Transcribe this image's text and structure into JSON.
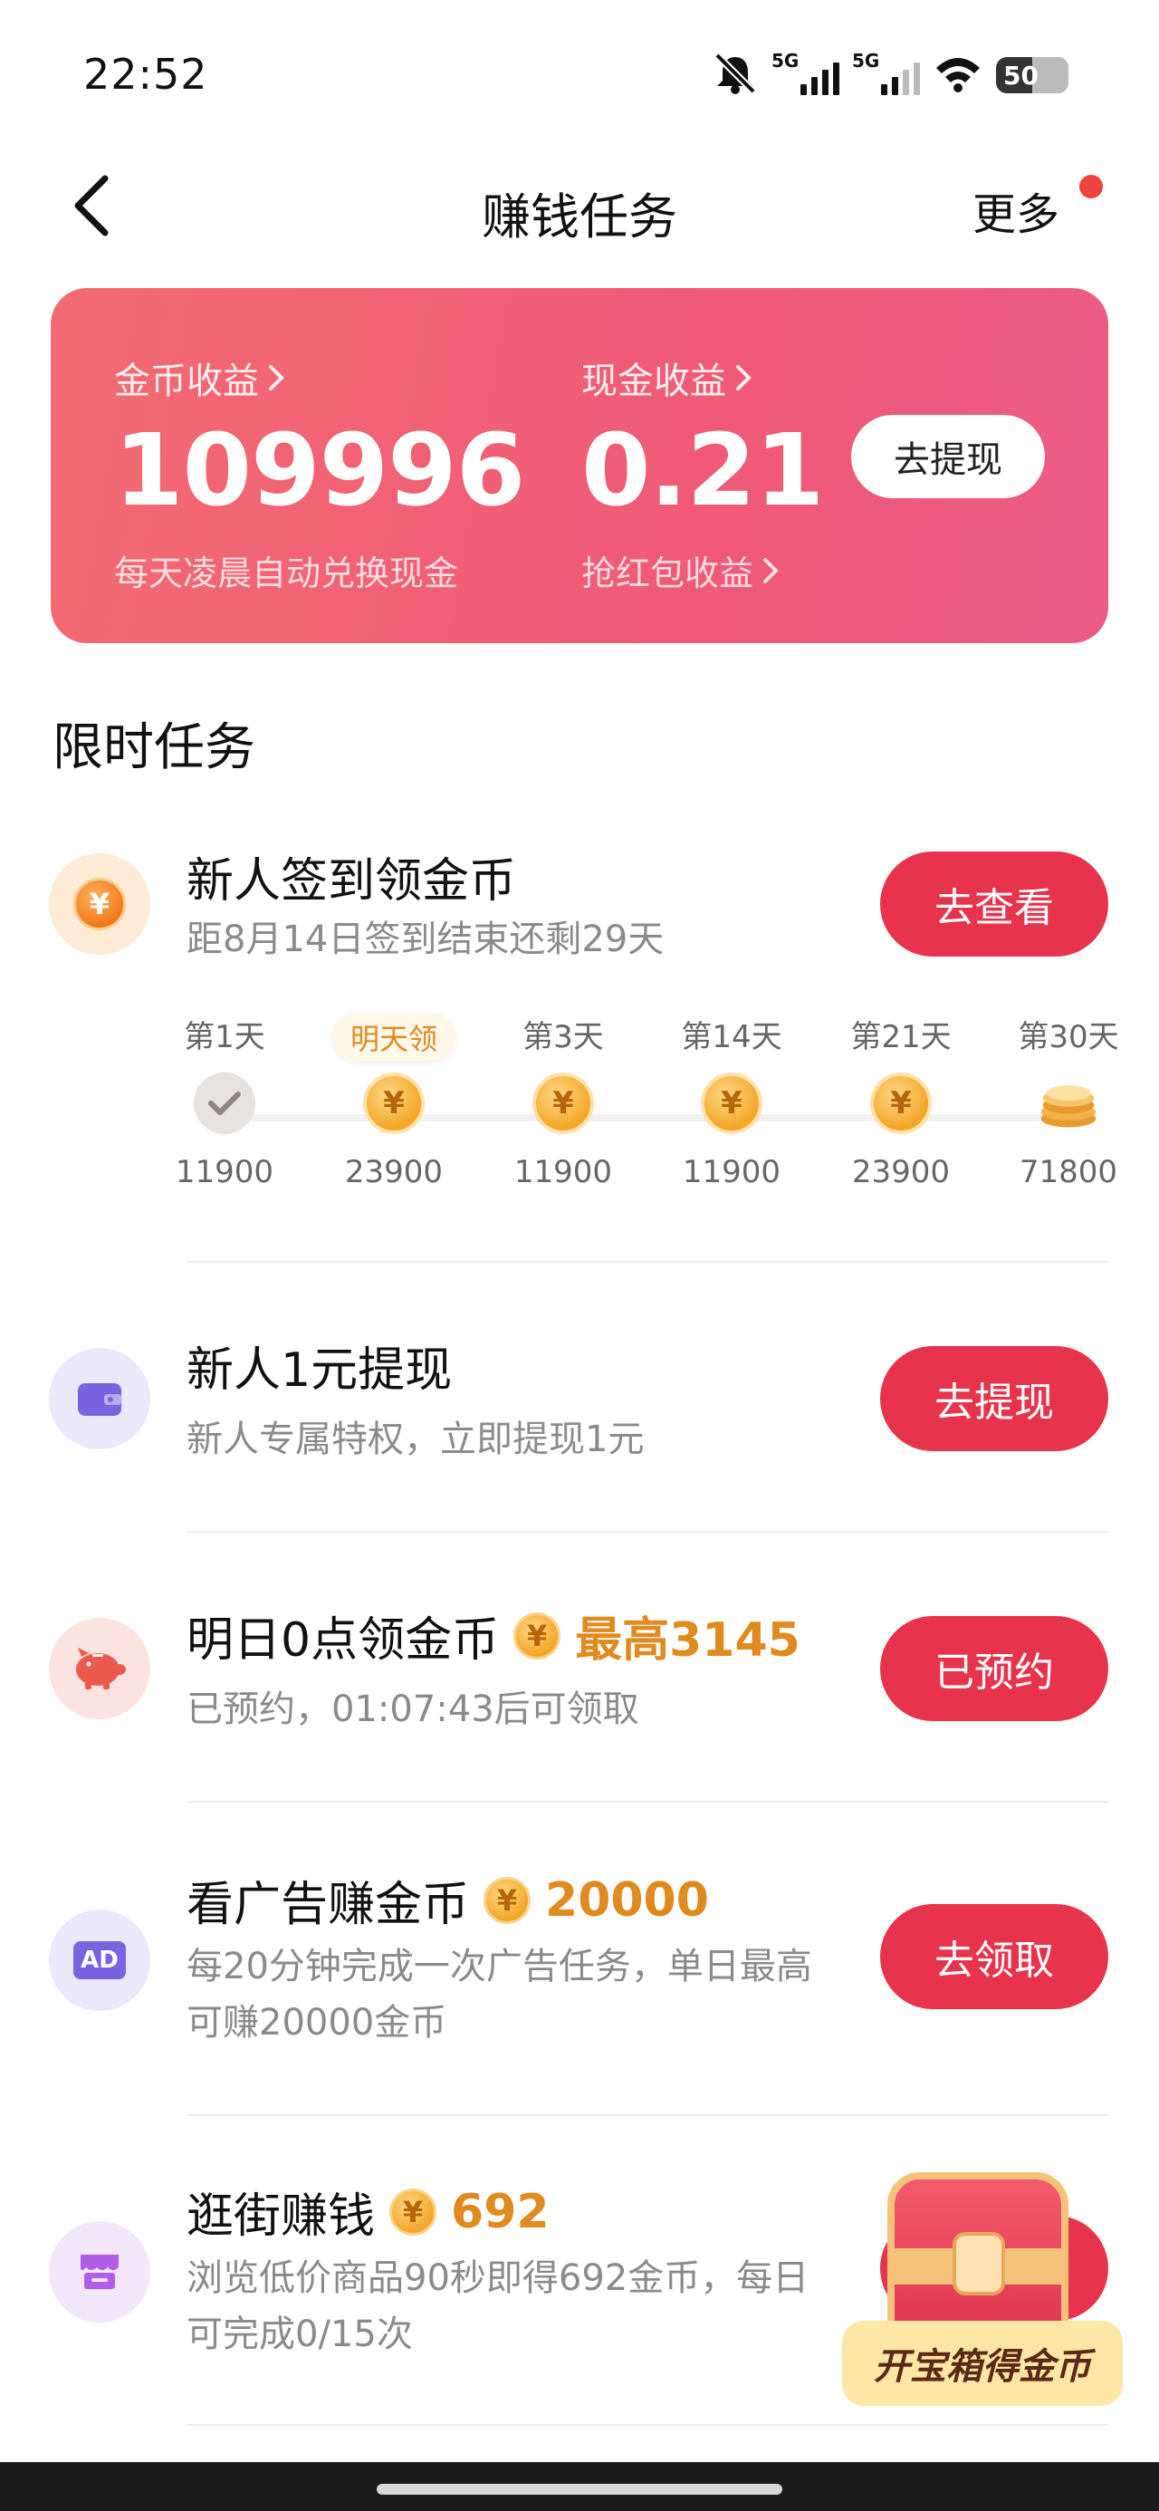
{
  "status_bar": {
    "time": "22:52",
    "network1": "5G",
    "network2": "5G",
    "battery": "50",
    "icons": [
      "mute-icon",
      "signal-icon",
      "wifi-icon",
      "battery-icon"
    ]
  },
  "header": {
    "title": "赚钱任务",
    "more_label": "更多"
  },
  "earnings": {
    "coins_label": "金币收益",
    "coins_value": "109996",
    "coins_note": "每天凌晨自动兑换现金",
    "cash_label": "现金收益",
    "cash_value": "0.21",
    "cash_note": "抢红包收益",
    "withdraw_label": "去提现"
  },
  "section_title": "限时任务",
  "tasks": [
    {
      "title": "新人签到领金币",
      "desc": "距8月14日签到结束还剩29天",
      "button": "去查看"
    },
    {
      "title": "新人1元提现",
      "desc": "新人专属特权，立即提现1元",
      "button": "去提现"
    },
    {
      "title": "明日0点领金币",
      "reward": "最高3145",
      "desc": "已预约，01:07:43后可领取",
      "button": "已预约"
    },
    {
      "title": "看广告赚金币",
      "reward": "20000",
      "desc": "每20分钟完成一次广告任务，单日最高可赚20000金币",
      "button": "去领取"
    },
    {
      "title": "逛街赚钱",
      "reward": "692",
      "desc": "浏览低价商品90秒即得692金币，每日可完成0/15次",
      "button": ""
    }
  ],
  "signin_days": [
    {
      "label": "第1天",
      "value": "11900",
      "state": "done"
    },
    {
      "label": "",
      "badge": "明天领",
      "value": "23900",
      "state": "coin"
    },
    {
      "label": "第3天",
      "value": "11900",
      "state": "coin"
    },
    {
      "label": "第14天",
      "value": "11900",
      "state": "coin"
    },
    {
      "label": "第21天",
      "value": "23900",
      "state": "coin"
    },
    {
      "label": "第30天",
      "value": "71800",
      "state": "coin-stack"
    }
  ],
  "coin_symbol": "¥",
  "ad_icon_text": "AD",
  "treasure": {
    "label": "开宝箱得金币"
  },
  "colors": {
    "primary_button": "#e8334d",
    "card_gradient_start": "#f36b72",
    "card_gradient_end": "#ec5b86",
    "reward_orange": "#e08a1f"
  }
}
